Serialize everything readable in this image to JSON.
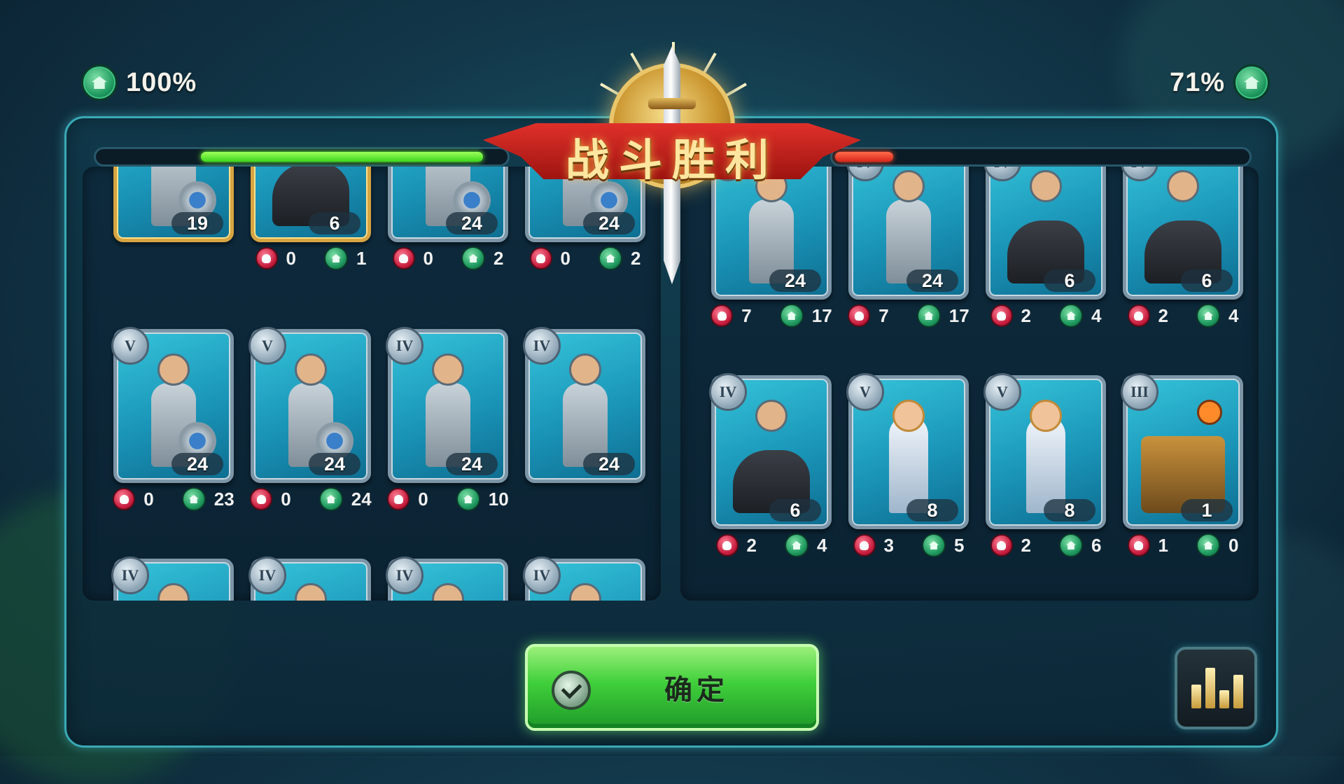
{
  "battle": {
    "title": "战斗胜利",
    "left_percent": "100%",
    "right_percent": "71%",
    "left_bar_level": 0.72,
    "right_bar_level": 0.14
  },
  "left_units": [
    {
      "tier": "",
      "count": "19",
      "kills": "",
      "heals": "",
      "art": "soldier",
      "gold": true
    },
    {
      "tier": "",
      "count": "6",
      "kills": "0",
      "heals": "1",
      "art": "horse",
      "gold": true
    },
    {
      "tier": "",
      "count": "24",
      "kills": "0",
      "heals": "2",
      "art": "soldier",
      "gold": false
    },
    {
      "tier": "",
      "count": "24",
      "kills": "0",
      "heals": "2",
      "art": "soldier",
      "gold": false
    },
    {
      "tier": "V",
      "count": "24",
      "kills": "0",
      "heals": "23",
      "art": "soldier",
      "gold": false
    },
    {
      "tier": "V",
      "count": "24",
      "kills": "0",
      "heals": "24",
      "art": "soldier",
      "gold": false
    },
    {
      "tier": "IV",
      "count": "24",
      "kills": "0",
      "heals": "10",
      "art": "archer",
      "gold": false
    },
    {
      "tier": "IV",
      "count": "24",
      "kills": "",
      "heals": "",
      "art": "archer",
      "gold": false
    },
    {
      "tier": "IV",
      "count": "",
      "kills": "",
      "heals": "",
      "art": "soldier",
      "gold": false
    },
    {
      "tier": "IV",
      "count": "",
      "kills": "",
      "heals": "",
      "art": "soldier",
      "gold": false
    },
    {
      "tier": "IV",
      "count": "",
      "kills": "",
      "heals": "",
      "art": "soldier",
      "gold": false
    },
    {
      "tier": "IV",
      "count": "",
      "kills": "",
      "heals": "",
      "art": "soldier",
      "gold": false
    }
  ],
  "right_units": [
    {
      "tier": "IV",
      "count": "24",
      "kills": "7",
      "heals": "17",
      "art": "archer"
    },
    {
      "tier": "IV",
      "count": "24",
      "kills": "7",
      "heals": "17",
      "art": "archer"
    },
    {
      "tier": "IV",
      "count": "6",
      "kills": "2",
      "heals": "4",
      "art": "horse"
    },
    {
      "tier": "IV",
      "count": "6",
      "kills": "2",
      "heals": "4",
      "art": "horse"
    },
    {
      "tier": "IV",
      "count": "6",
      "kills": "2",
      "heals": "4",
      "art": "horse"
    },
    {
      "tier": "V",
      "count": "8",
      "kills": "3",
      "heals": "5",
      "art": "mage"
    },
    {
      "tier": "V",
      "count": "8",
      "kills": "2",
      "heals": "6",
      "art": "mage"
    },
    {
      "tier": "III",
      "count": "1",
      "kills": "1",
      "heals": "0",
      "art": "siege"
    }
  ],
  "buttons": {
    "confirm_label": "确定",
    "confirm_icon": "check-circle-icon",
    "stats_icon": "bar-chart-icon"
  },
  "colors": {
    "ally_bar": "#3dd61c",
    "enemy_bar": "#d8261b",
    "confirm": "#3fcf3a",
    "frame_glow": "#3aa9b6"
  }
}
